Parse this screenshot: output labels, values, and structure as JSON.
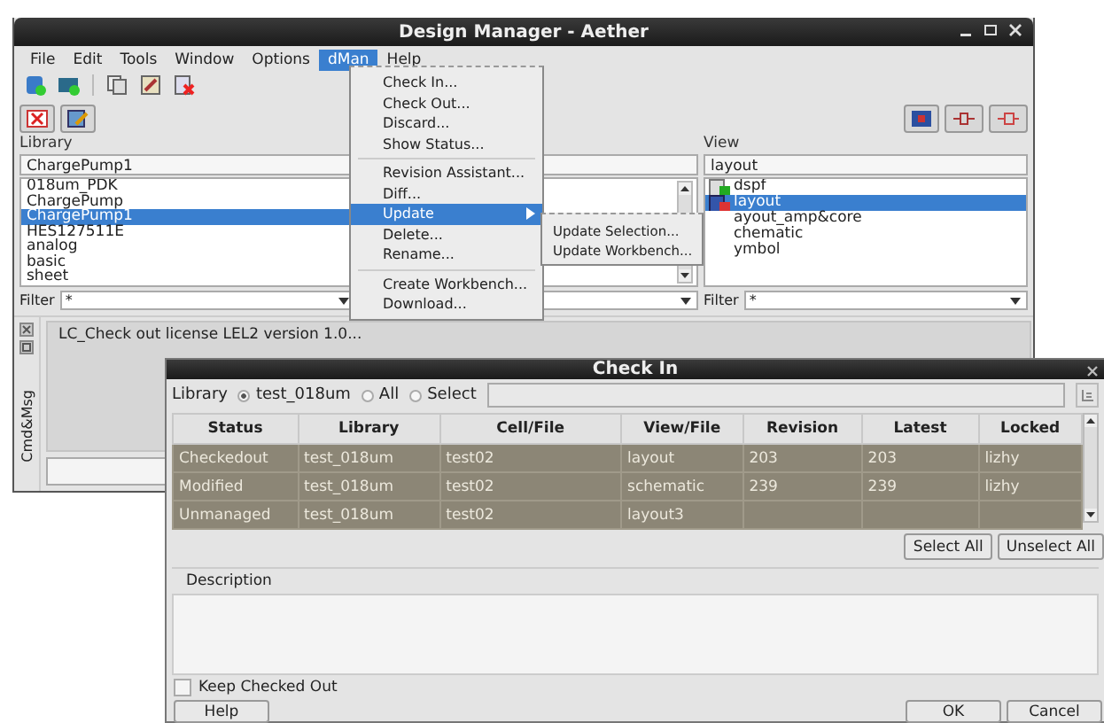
{
  "main_window": {
    "title": "Design Manager - Aether",
    "menu": [
      {
        "label": "File",
        "selected": false
      },
      {
        "label": "Edit",
        "selected": false
      },
      {
        "label": "Tools",
        "selected": false
      },
      {
        "label": "Window",
        "selected": false
      },
      {
        "label": "Options",
        "selected": false
      },
      {
        "label": "dMan",
        "selected": true
      },
      {
        "label": "Help",
        "selected": false
      }
    ],
    "library": {
      "label": "Library",
      "value": "ChargePump1",
      "items": [
        {
          "label": "018um_PDK",
          "selected": false
        },
        {
          "label": "ChargePump",
          "selected": false
        },
        {
          "label": "ChargePump1",
          "selected": true
        },
        {
          "label": "HES127511E",
          "selected": false
        },
        {
          "label": "analog",
          "selected": false
        },
        {
          "label": "basic",
          "selected": false
        },
        {
          "label": "sheet",
          "selected": false
        }
      ],
      "filter_label": "Filter",
      "filter_value": "*"
    },
    "view": {
      "label": "View",
      "value": "layout",
      "items": [
        {
          "label": "dspf",
          "selected": false,
          "kind": "document"
        },
        {
          "label": "layout",
          "selected": true,
          "kind": "layout"
        },
        {
          "label": "ayout_amp&core",
          "selected": false,
          "kind": "plain"
        },
        {
          "label": "chematic",
          "selected": false,
          "kind": "plain"
        },
        {
          "label": "ymbol",
          "selected": false,
          "kind": "plain"
        }
      ],
      "filter_label": "Filter",
      "filter_value": "*"
    },
    "messages": {
      "tab": "Cmd&Msg",
      "lines": [
        "LC_Check out license LEL2 version 1.0..."
      ]
    }
  },
  "dman_menu": {
    "items": [
      {
        "kind": "item",
        "label": "Check In..."
      },
      {
        "kind": "item",
        "label": "Check Out..."
      },
      {
        "kind": "item",
        "label": "Discard..."
      },
      {
        "kind": "item",
        "label": "Show Status..."
      },
      {
        "kind": "separator"
      },
      {
        "kind": "item",
        "label": "Revision Assistant..."
      },
      {
        "kind": "item",
        "label": "Diff..."
      },
      {
        "kind": "submenu",
        "label": "Update",
        "highlighted": true
      },
      {
        "kind": "item",
        "label": "Delete..."
      },
      {
        "kind": "item",
        "label": "Rename..."
      },
      {
        "kind": "separator"
      },
      {
        "kind": "item",
        "label": "Create Workbench..."
      },
      {
        "kind": "item",
        "label": "Download..."
      }
    ]
  },
  "update_submenu": {
    "items": [
      "Update Selection...",
      "Update Workbench..."
    ]
  },
  "check_in": {
    "title": "Check In",
    "scope_label": "Library",
    "scopes": [
      {
        "label": "test_018um",
        "selected": true
      },
      {
        "label": "All",
        "selected": false
      },
      {
        "label": "Select",
        "selected": false
      }
    ],
    "columns": [
      "Status",
      "Library",
      "Cell/File",
      "View/File",
      "Revision",
      "Latest",
      "Locked"
    ],
    "rows": [
      {
        "selected": true,
        "cells": [
          "Checkedout",
          "test_018um",
          "test02",
          "layout",
          "203",
          "203",
          "lizhy"
        ]
      },
      {
        "selected": true,
        "cells": [
          "Modified",
          "test_018um",
          "test02",
          "schematic",
          "239",
          "239",
          "lizhy"
        ]
      },
      {
        "selected": true,
        "cells": [
          "Unmanaged",
          "test_018um",
          "test02",
          "layout3",
          "",
          "",
          ""
        ]
      }
    ],
    "select_all": "Select All",
    "unselect_all": "Unselect All",
    "description_label": "Description",
    "keep_checked_out": {
      "label": "Keep Checked Out",
      "checked": false
    },
    "help": "Help",
    "ok": "OK",
    "cancel": "Cancel"
  }
}
